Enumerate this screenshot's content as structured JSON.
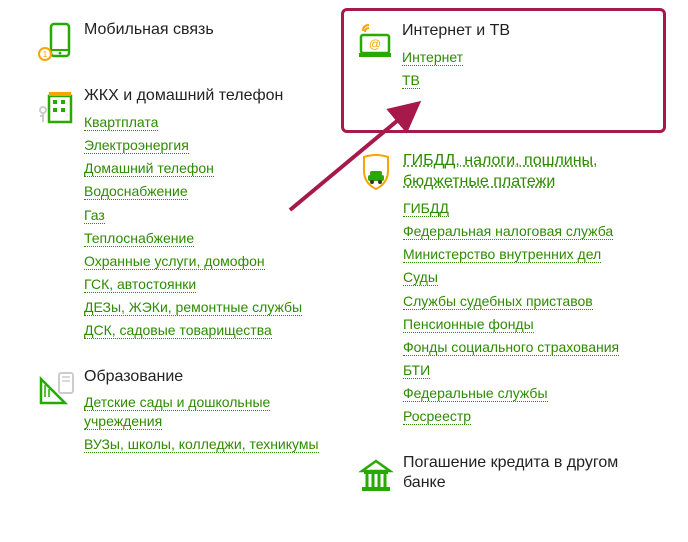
{
  "left": [
    {
      "id": "mobile",
      "title": "Мобильная связь",
      "title_is_link": false,
      "links": []
    },
    {
      "id": "housing",
      "title": "ЖКХ и домашний телефон",
      "title_is_link": false,
      "links": [
        "Квартплата",
        "Электроэнергия",
        "Домашний телефон",
        "Водоснабжение",
        "Газ",
        "Теплоснабжение",
        "Охранные услуги, домофон",
        "ГСК, автостоянки",
        "ДЕЗы, ЖЭКи, ремонтные службы",
        "ДСК, садовые товарищества"
      ]
    },
    {
      "id": "education",
      "title": "Образование",
      "title_is_link": false,
      "links": [
        "Детские сады и дошкольные учреждения",
        "ВУЗы, школы, колледжи, техникумы"
      ]
    }
  ],
  "right": [
    {
      "id": "internet",
      "title": "Интернет и ТВ",
      "title_is_link": false,
      "highlighted": true,
      "links": [
        "Интернет",
        "ТВ"
      ]
    },
    {
      "id": "gov",
      "title": "ГИБДД, налоги, пошлины, бюджетные платежи",
      "title_is_link": true,
      "links": [
        "ГИБДД",
        "Федеральная налоговая служба",
        "Министерство внутренних дел",
        "Суды",
        "Службы судебных приставов",
        "Пенсионные фонды",
        "Фонды социального страхования",
        "БТИ",
        "Федеральные службы",
        "Росреестр"
      ]
    },
    {
      "id": "loan",
      "title": "Погашение кредита в другом банке",
      "title_is_link": false,
      "links": []
    }
  ]
}
